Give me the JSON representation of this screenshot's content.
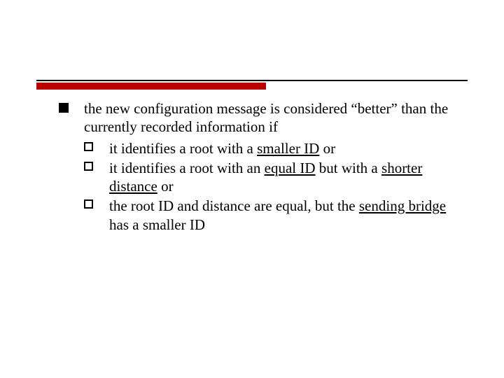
{
  "bullet": {
    "intro": "the new configuration message is considered “better” than the currently recorded information if",
    "subs": [
      {
        "pre": "it identifies a root with a ",
        "u1": "smaller ID",
        "post": " or"
      },
      {
        "pre": "it identifies a root with an ",
        "u1": "equal ID",
        "mid": " but with a ",
        "u2": "shorter distance",
        "post": " or"
      },
      {
        "pre": "the root ID and distance are equal, but the ",
        "u1": "sending bridge",
        "post": " has a smaller ID"
      }
    ]
  }
}
